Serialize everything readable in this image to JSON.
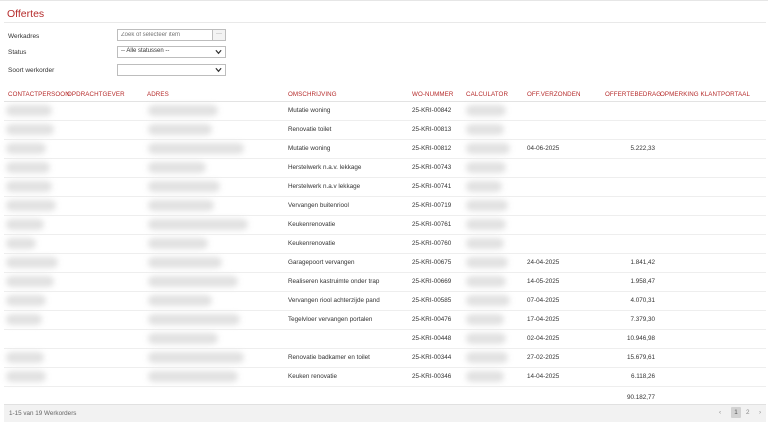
{
  "page": {
    "title": "Offertes"
  },
  "filters": {
    "werkadres": {
      "label": "Werkadres",
      "placeholder": "Zoek of selecteer item",
      "button_label": "···"
    },
    "status": {
      "label": "Status",
      "selected": "-- Alle statussen --"
    },
    "soort": {
      "label": "Soort werkorder",
      "selected": ""
    }
  },
  "table": {
    "columns": [
      "CONTACTPERSOON",
      "OPDRACHTGEVER",
      "ADRES",
      "OMSCHRIJVING",
      "WO-NUMMER",
      "CALCULATOR",
      "OFF.VERZONDEN",
      "OFFERTEBEDRAG",
      "OPMERKING KLANTPORTAAL"
    ],
    "rows": [
      {
        "omschrijving": "Mutatie woning",
        "wo": "25-KRI-00842",
        "verzonden": "",
        "bedrag": ""
      },
      {
        "omschrijving": "Renovatie toilet",
        "wo": "25-KRI-00813",
        "verzonden": "",
        "bedrag": ""
      },
      {
        "omschrijving": "Mutatie woning",
        "wo": "25-KRI-00812",
        "verzonden": "04-06-2025",
        "bedrag": "5.222,33"
      },
      {
        "omschrijving": "Herstelwerk n.a.v. lekkage",
        "wo": "25-KRI-00743",
        "verzonden": "",
        "bedrag": ""
      },
      {
        "omschrijving": "Herstelwerk n.a.v lekkage",
        "wo": "25-KRI-00741",
        "verzonden": "",
        "bedrag": ""
      },
      {
        "omschrijving": "Vervangen buitenriool",
        "wo": "25-KRI-00719",
        "verzonden": "",
        "bedrag": ""
      },
      {
        "omschrijving": "Keukenrenovatie",
        "wo": "25-KRI-00761",
        "verzonden": "",
        "bedrag": ""
      },
      {
        "omschrijving": "Keukenrenovatie",
        "wo": "25-KRI-00760",
        "verzonden": "",
        "bedrag": ""
      },
      {
        "omschrijving": "Garagepoort vervangen",
        "wo": "25-KRI-00675",
        "verzonden": "24-04-2025",
        "bedrag": "1.841,42"
      },
      {
        "omschrijving": "Realiseren kastruimte onder trap",
        "wo": "25-KRI-00669",
        "verzonden": "14-05-2025",
        "bedrag": "1.958,47"
      },
      {
        "omschrijving": "Vervangen riool achterzijde pand",
        "wo": "25-KRI-00585",
        "verzonden": "07-04-2025",
        "bedrag": "4.070,31"
      },
      {
        "omschrijving": "Tegelvloer vervangen portalen",
        "wo": "25-KRI-00476",
        "verzonden": "17-04-2025",
        "bedrag": "7.379,30"
      },
      {
        "omschrijving": "",
        "wo": "25-KRI-00448",
        "verzonden": "02-04-2025",
        "bedrag": "10.946,98"
      },
      {
        "omschrijving": "Renovatie badkamer en toilet",
        "wo": "25-KRI-00344",
        "verzonden": "27-02-2025",
        "bedrag": "15.679,61"
      },
      {
        "omschrijving": "Keuken renovatie",
        "wo": "25-KRI-00346",
        "verzonden": "14-04-2025",
        "bedrag": "6.118,26"
      }
    ],
    "total": "90.182,77"
  },
  "footer": {
    "summary": "1-15 van 19 Werkorders",
    "prev": "‹",
    "pages": [
      "1",
      "2"
    ],
    "next": "›"
  },
  "colors": {
    "accent": "#b52a2a",
    "rule": "#eeeeee",
    "footer_bg": "#f2f2f2"
  }
}
